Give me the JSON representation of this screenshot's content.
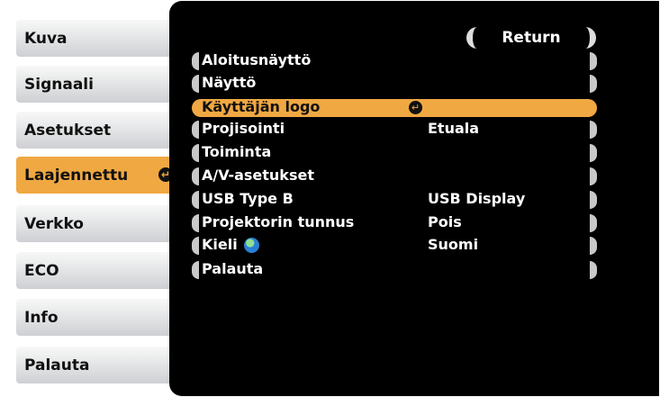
{
  "tabs": [
    {
      "label": "Kuva"
    },
    {
      "label": "Signaali"
    },
    {
      "label": "Asetukset"
    },
    {
      "label": "Laajennettu",
      "active": true
    },
    {
      "label": "Verkko"
    },
    {
      "label": "ECO"
    },
    {
      "label": "Info"
    },
    {
      "label": "Palauta"
    }
  ],
  "return_label": "Return",
  "enter_glyph": "↵",
  "menu": [
    {
      "label": "Aloitusnäyttö",
      "value": ""
    },
    {
      "label": "Näyttö",
      "value": ""
    },
    {
      "label": "Käyttäjän logo",
      "value": "",
      "selected": true
    },
    {
      "label": "Projisointi",
      "value": "Etuala"
    },
    {
      "label": "Toiminta",
      "value": ""
    },
    {
      "label": "A/V-asetukset",
      "value": ""
    },
    {
      "label": "USB Type B",
      "value": "USB Display"
    },
    {
      "label": "Projektorin tunnus",
      "value": "Pois"
    },
    {
      "label": "Kieli",
      "value": "Suomi",
      "icon": "globe-icon"
    },
    {
      "label": "Palauta",
      "value": ""
    }
  ],
  "colors": {
    "accent": "#f0a842",
    "panel": "#000000",
    "tab": "#d8d9dc"
  }
}
